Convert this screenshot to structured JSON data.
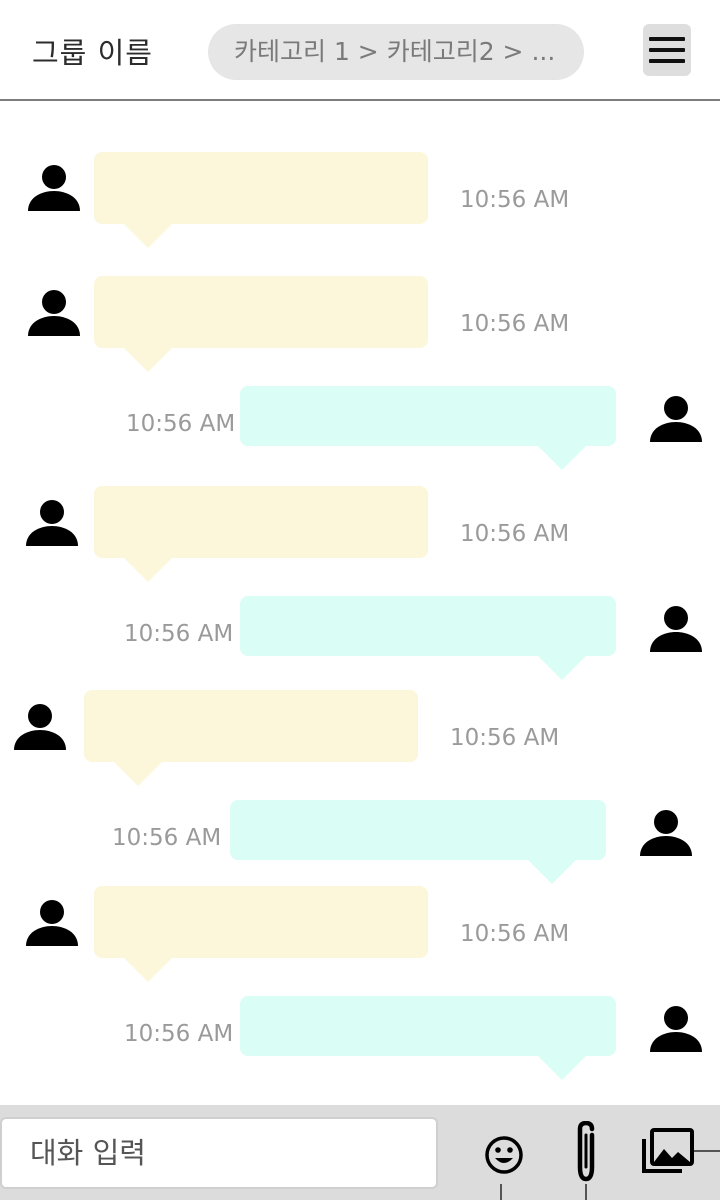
{
  "header": {
    "group_name": "그룹 이름",
    "breadcrumb": "카테고리 1 > 카테고리2 > ..."
  },
  "messages": [
    {
      "direction": "incoming",
      "time": "10:56 AM"
    },
    {
      "direction": "incoming",
      "time": "10:56 AM"
    },
    {
      "direction": "outgoing",
      "time": "10:56 AM"
    },
    {
      "direction": "incoming",
      "time": "10:56 AM"
    },
    {
      "direction": "outgoing",
      "time": "10:56 AM"
    },
    {
      "direction": "incoming",
      "time": "10:56 AM"
    },
    {
      "direction": "outgoing",
      "time": "10:56 AM"
    },
    {
      "direction": "incoming",
      "time": "10:56 AM"
    },
    {
      "direction": "outgoing",
      "time": "10:56 AM"
    }
  ],
  "composer": {
    "placeholder": "대화 입력",
    "icons": [
      "emoji-icon",
      "attachment-icon",
      "gallery-icon"
    ]
  },
  "colors": {
    "incoming_bubble": "#fcf7da",
    "outgoing_bubble": "#dafdf5",
    "header_divider": "#7c7c7c",
    "composer_background": "#dcdcdc"
  }
}
